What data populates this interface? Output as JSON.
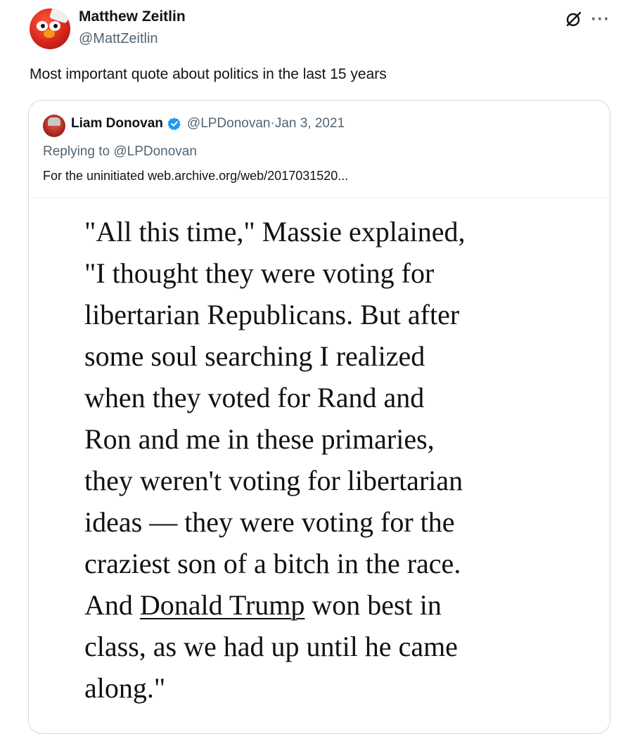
{
  "post": {
    "author_name": "Matthew Zeitlin",
    "author_handle": "@MattZeitlin",
    "text": "Most important quote about politics in the last 15 years",
    "more_label": "···"
  },
  "quoted": {
    "author_name": "Liam Donovan",
    "author_handle": "@LPDonovan",
    "separator": " · ",
    "date": "Jan 3, 2021",
    "replying_prefix": "Replying to ",
    "replying_handle": "@LPDonovan",
    "text": "For the uninitiated web.archive.org/web/2017031520...",
    "image_quote_lines": [
      "\"All this time,\" Massie explained,",
      "\"I thought they were voting for",
      "libertarian Republicans. But after",
      "some soul searching I realized",
      "when they voted for Rand and",
      "Ron and me in these primaries,",
      "they weren't voting for libertarian",
      "ideas — they were voting for the",
      "craziest son of a bitch in the race."
    ],
    "line10_pre": "And ",
    "line10_link": "Donald Trump",
    "line10_post": " won best in",
    "image_quote_tail": [
      "class, as we had up until he came",
      "along.\""
    ]
  },
  "colors": {
    "text_primary": "#0f1419",
    "text_secondary": "#536471",
    "border": "#cfd9de",
    "verified": "#1d9bf0"
  },
  "icons": {
    "grok": "grok-icon",
    "more": "more-icon",
    "verified": "verified-badge-icon"
  }
}
